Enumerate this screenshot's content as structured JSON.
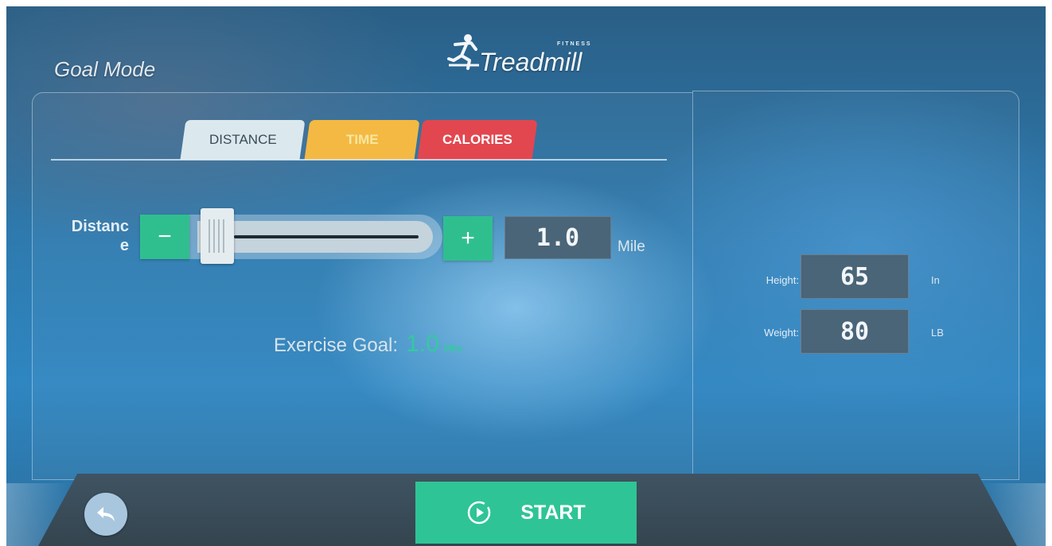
{
  "header": {
    "mode_title": "Goal Mode",
    "brand_name": "Treadmill",
    "brand_tagline": "FITNESS"
  },
  "tabs": [
    {
      "label": "DISTANCE",
      "active": true,
      "color": "#dbe9ee"
    },
    {
      "label": "TIME",
      "active": false,
      "color": "#f4b942"
    },
    {
      "label": "CALORIES",
      "active": false,
      "color": "#e2474f"
    }
  ],
  "distance": {
    "label": "Distanc e",
    "minus_label": "−",
    "plus_label": "+",
    "value": "1.0",
    "unit": "Mile",
    "slider_level": 0.0
  },
  "goal": {
    "label": "Exercise Goal:",
    "value": "1.0",
    "unit": "Mile"
  },
  "profile": {
    "height_label": "Height:",
    "height_value": "65",
    "height_unit": "In",
    "weight_label": "Weight:",
    "weight_value": "80",
    "weight_unit": "LB"
  },
  "footer": {
    "back_icon": "back-arrow-icon",
    "start_label": "START",
    "start_icon": "play-circle-icon"
  },
  "colors": {
    "accent_green": "#2fc495",
    "value_box": "#4a6478",
    "goal_green": "#35c9a0"
  }
}
